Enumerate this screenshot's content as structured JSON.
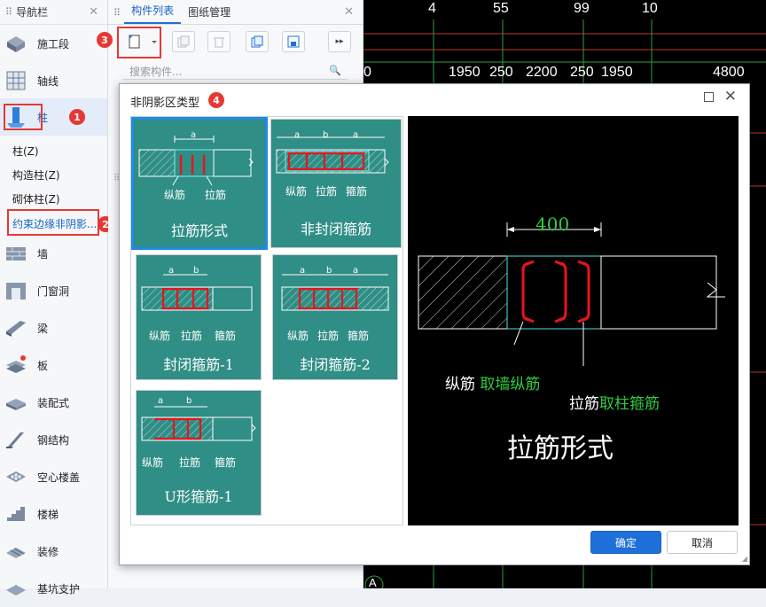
{
  "nav": {
    "title": "导航栏",
    "items": [
      {
        "label": "施工段",
        "icon": "construction-section-icon"
      },
      {
        "label": "轴线",
        "icon": "grid-axis-icon"
      },
      {
        "label": "柱",
        "icon": "column-icon"
      },
      {
        "label": "墙",
        "icon": "wall-icon"
      },
      {
        "label": "门窗洞",
        "icon": "door-window-icon"
      },
      {
        "label": "梁",
        "icon": "beam-icon"
      },
      {
        "label": "板",
        "icon": "slab-icon"
      },
      {
        "label": "装配式",
        "icon": "prefab-icon"
      },
      {
        "label": "钢结构",
        "icon": "steel-structure-icon"
      },
      {
        "label": "空心楼盖",
        "icon": "hollow-floor-icon"
      },
      {
        "label": "楼梯",
        "icon": "stair-icon"
      },
      {
        "label": "装修",
        "icon": "decoration-icon"
      },
      {
        "label": "基坑支护",
        "icon": "foundation-pit-icon"
      }
    ],
    "column_sub": [
      "柱(Z)",
      "构造柱(Z)",
      "砌体柱(Z)",
      "约束边缘非阴影..."
    ]
  },
  "panel": {
    "tabs": [
      "构件列表",
      "图纸管理"
    ],
    "search_placeholder": "搜索构件..."
  },
  "cad": {
    "axis_numbers": [
      "4",
      "55",
      "99",
      "10"
    ],
    "dimensions": [
      "0",
      "1950",
      "250",
      "2200",
      "250",
      "1950",
      "4800"
    ],
    "bottom_label": "A"
  },
  "dialog": {
    "title": "非阴影区类型",
    "cards": [
      {
        "name": "拉筋形式",
        "labels": [
          "纵筋",
          "拉筋"
        ],
        "dims": [
          "a"
        ]
      },
      {
        "name": "非封闭箍筋",
        "labels": [
          "纵筋",
          "拉筋",
          "箍筋"
        ],
        "dims": [
          "a",
          "b",
          "a"
        ]
      },
      {
        "name": "封闭箍筋-1",
        "labels": [
          "纵筋",
          "拉筋",
          "箍筋"
        ],
        "dims": [
          "a",
          "b"
        ]
      },
      {
        "name": "封闭箍筋-2",
        "labels": [
          "纵筋",
          "拉筋",
          "箍筋"
        ],
        "dims": [
          "a",
          "b",
          "a"
        ]
      },
      {
        "name": "U形箍筋-1",
        "labels": [
          "纵筋",
          "拉筋",
          "箍筋"
        ],
        "dims": [
          "a",
          "b"
        ]
      }
    ],
    "preview": {
      "dimension": "400",
      "label1_prefix": "纵筋",
      "label1_value": "取墙纵筋",
      "label2_prefix": "拉筋",
      "label2_value": "取柱箍筋",
      "name": "拉筋形式"
    },
    "ok_label": "确定",
    "cancel_label": "取消"
  },
  "callouts": [
    "1",
    "2",
    "3",
    "4"
  ],
  "colors": {
    "accent": "#1e6fd9",
    "card": "#2f8e86",
    "callout": "#e53935",
    "rebar": "#e8141c",
    "cad_green": "#2ecc40"
  }
}
